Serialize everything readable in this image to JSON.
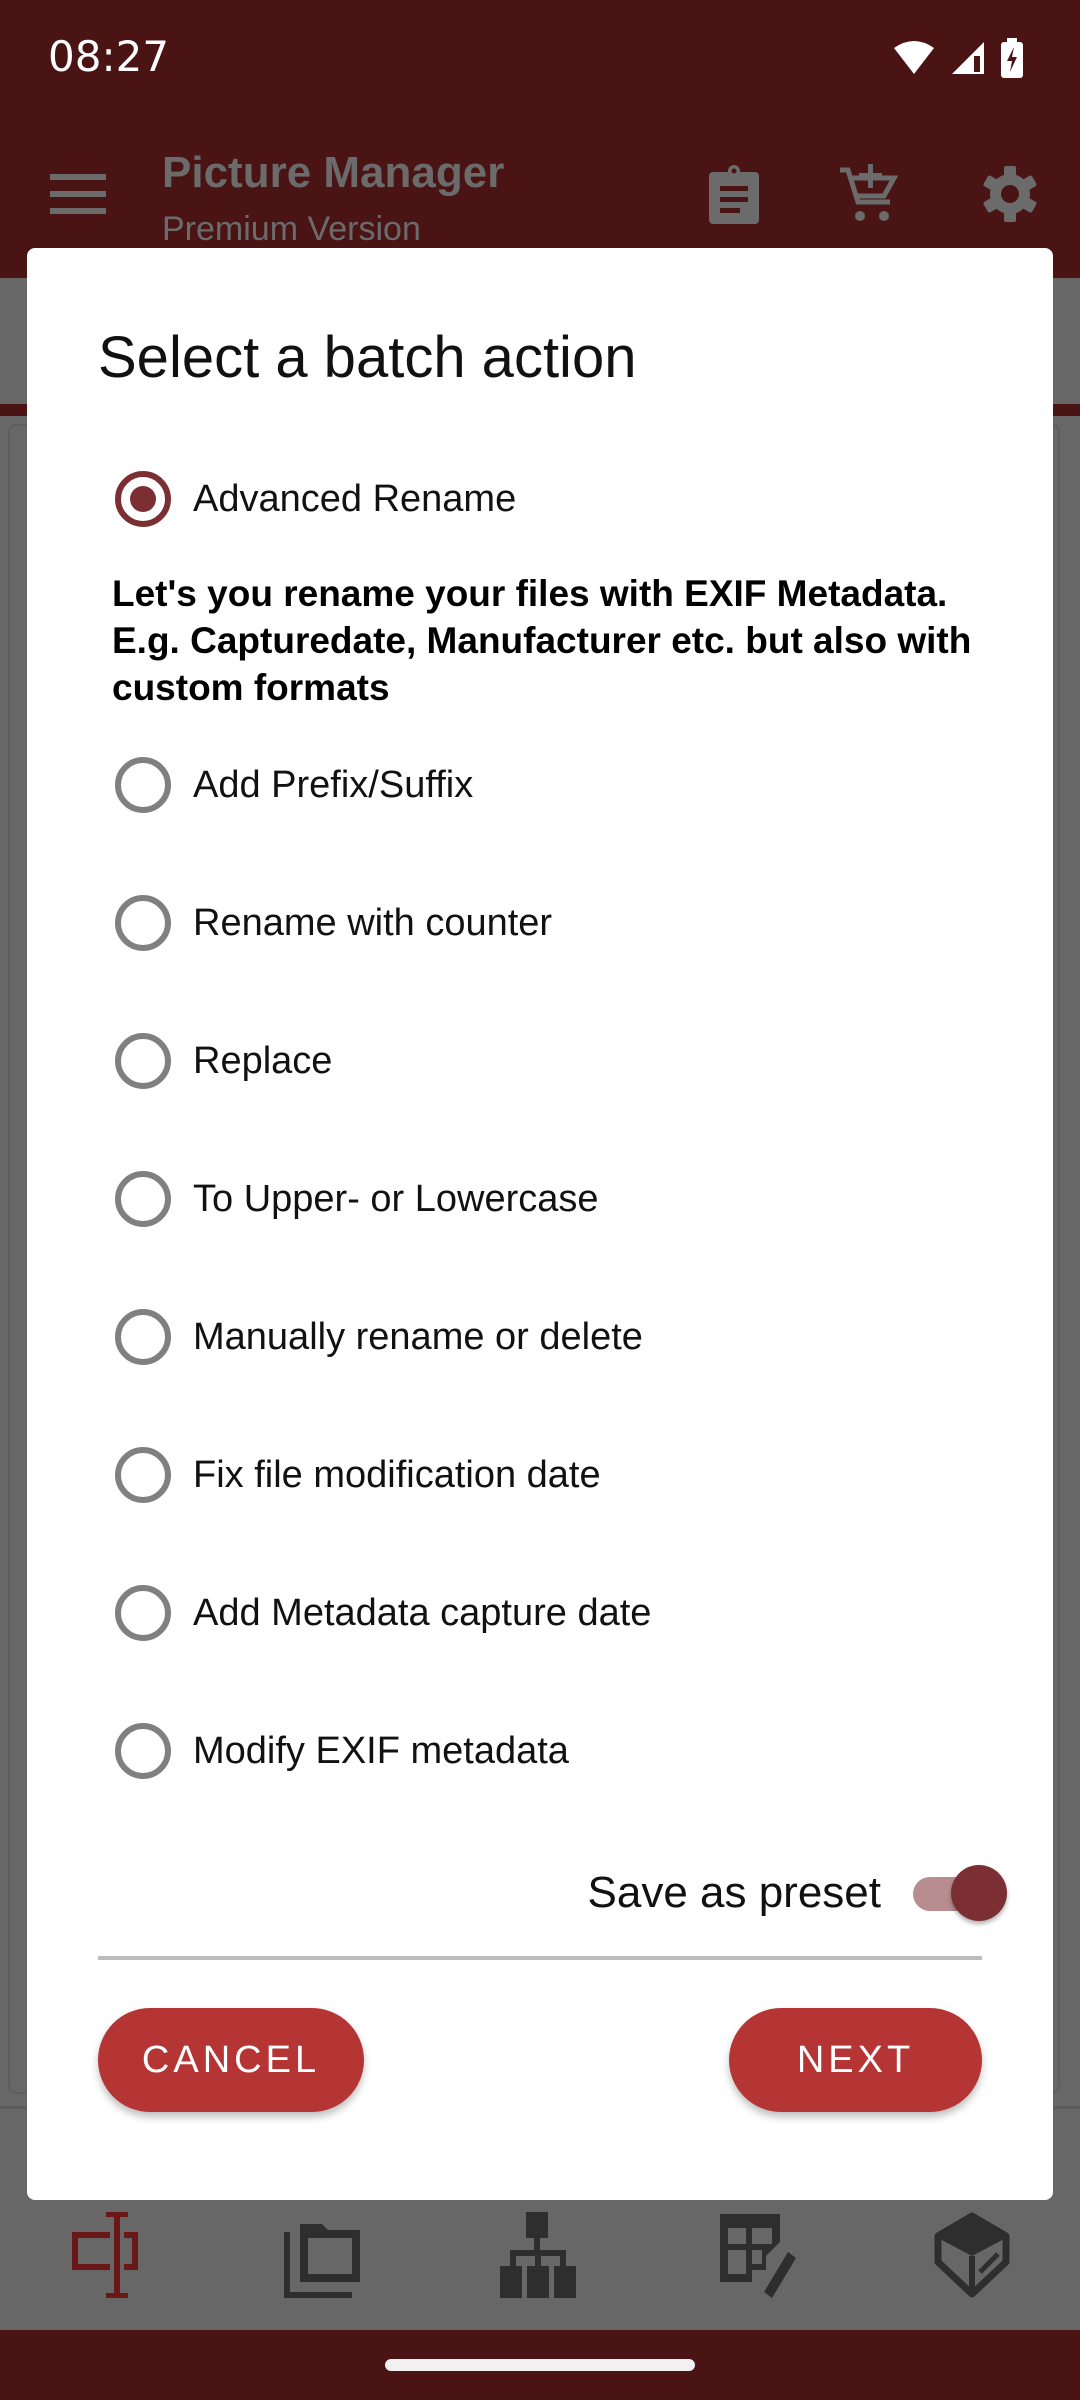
{
  "status_bar": {
    "time": "08:27",
    "icons": [
      "wifi-icon",
      "cell-signal-icon",
      "battery-charging-icon"
    ]
  },
  "app_bar": {
    "title": "Picture Manager",
    "subtitle": "Premium Version",
    "actions": [
      "clipboard-icon",
      "add-to-cart-icon",
      "settings-gear-icon"
    ]
  },
  "dialog": {
    "title": "Select a batch action",
    "selected_option": "Advanced Rename",
    "options": [
      {
        "label": "Advanced Rename",
        "checked": true
      },
      {
        "label": "Add Prefix/Suffix",
        "checked": false
      },
      {
        "label": "Rename with counter",
        "checked": false
      },
      {
        "label": "Replace",
        "checked": false
      },
      {
        "label": "To Upper- or Lowercase",
        "checked": false
      },
      {
        "label": "Manually rename or delete",
        "checked": false
      },
      {
        "label": "Fix file modification date",
        "checked": false
      },
      {
        "label": "Add Metadata capture date",
        "checked": false
      },
      {
        "label": "Modify EXIF metadata",
        "checked": false
      }
    ],
    "description": "Let's you rename your files with EXIF Metadata. E.g. Capturedate, Manufacturer etc. but also with custom formats",
    "save_preset": {
      "label": "Save as preset",
      "on": true
    },
    "cancel_label": "CANCEL",
    "next_label": "NEXT"
  },
  "bottom_nav": {
    "items": [
      "rename-cursor-icon",
      "folder-copy-icon",
      "hierarchy-icon",
      "table-edit-icon",
      "box-icon"
    ],
    "active_index": 0
  },
  "colors": {
    "primary_dark": "#4a1414",
    "accent": "#7b2f33",
    "button": "#b53535",
    "scrim_gray": "#676767"
  }
}
